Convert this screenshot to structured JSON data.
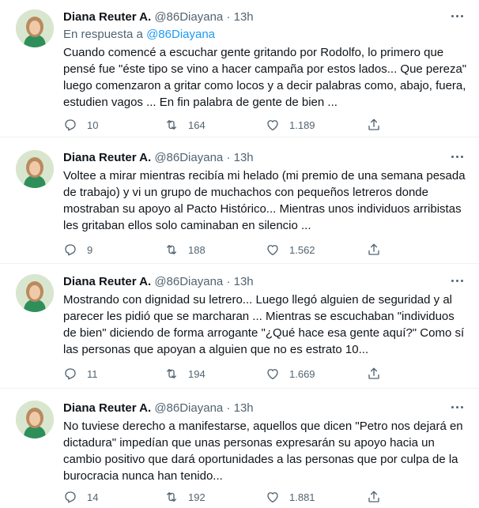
{
  "user": {
    "name": "Diana Reuter A.",
    "handle": "@86Diayana",
    "time": "13h"
  },
  "reply_prefix": "En respuesta a",
  "reply_handle": "@86Diayana",
  "separator": "·",
  "tweets": [
    {
      "text": "Cuando comencé a escuchar gente gritando por Rodolfo, lo primero que pensé fue \"éste tipo se vino a hacer campaña por estos lados... Que pereza\" luego comenzaron a gritar como locos y a decir palabras como, abajo, fuera, estudien vagos ... En fin palabra de gente de bien ...",
      "replies": "10",
      "retweets": "164",
      "likes": "1.189"
    },
    {
      "text": "Voltee a mirar mientras recibía mi helado (mi premio de una semana pesada de trabajo) y vi un grupo de muchachos con pequeños letreros donde mostraban su apoyo al Pacto Histórico... Mientras unos individuos arribistas les gritaban ellos solo caminaban en silencio ...",
      "replies": "9",
      "retweets": "188",
      "likes": "1.562"
    },
    {
      "text": "Mostrando con dignidad su letrero... Luego llegó alguien de seguridad y al parecer les pidió que se marcharan ... Mientras se escuchaban \"individuos de bien\" diciendo de forma arrogante \"¿Qué hace esa gente aquí?\" Como sí las personas que apoyan a alguien que no es estrato 10...",
      "replies": "11",
      "retweets": "194",
      "likes": "1.669"
    },
    {
      "text": "No tuviese derecho a manifestarse, aquellos que dicen \"Petro nos dejará en dictadura\" impedían que unas personas expresarán su apoyo hacia un cambio positivo que dará oportunidades a las personas que por culpa de la burocracia nunca han tenido...",
      "replies": "14",
      "retweets": "192",
      "likes": "1.881"
    }
  ],
  "icons": {
    "reply": "reply-icon",
    "retweet": "retweet-icon",
    "like": "heart-icon",
    "share": "share-icon",
    "more": "more-options-icon"
  },
  "colors": {
    "text": "#0f1419",
    "secondary": "#536471",
    "link": "#1d9bf0"
  }
}
